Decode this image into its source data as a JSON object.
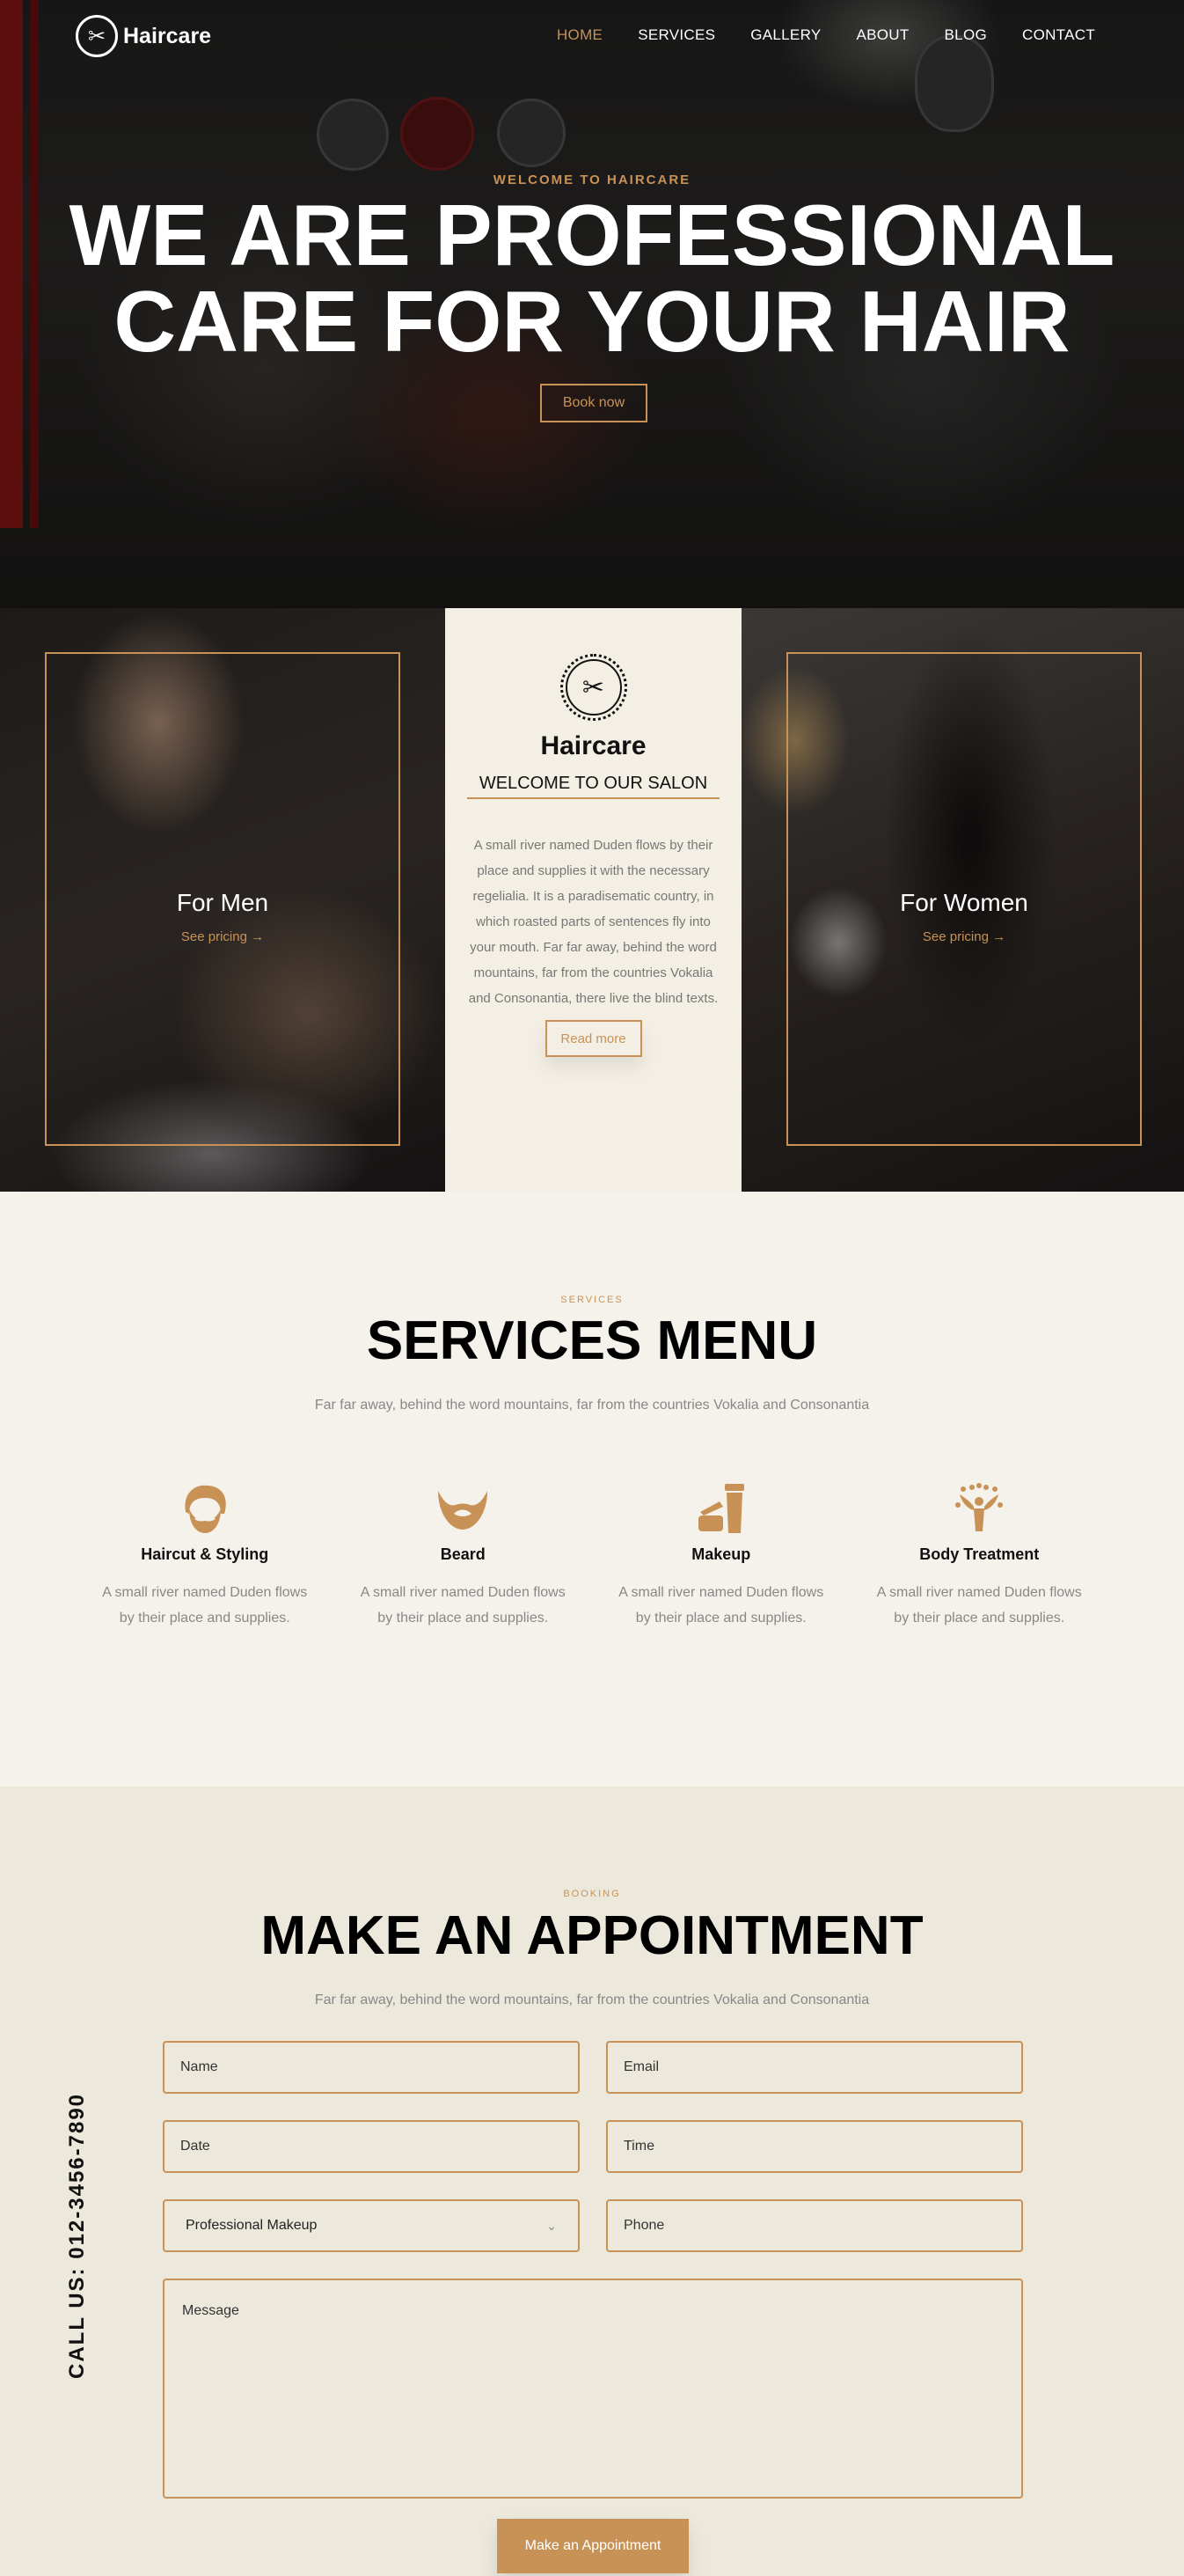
{
  "nav": {
    "logo": "Haircare",
    "items": [
      {
        "label": "HOME",
        "active": true
      },
      {
        "label": "SERVICES"
      },
      {
        "label": "GALLERY"
      },
      {
        "label": "ABOUT"
      },
      {
        "label": "BLOG"
      },
      {
        "label": "CONTACT"
      }
    ]
  },
  "hero": {
    "subtitle": "WELCOME TO HAIRCARE",
    "title_line1": "WE ARE PROFESSIONAL",
    "title_line2": "CARE FOR YOUR HAIR",
    "cta": "Book now"
  },
  "categories": {
    "men": {
      "title": "For Men",
      "link": "See pricing →"
    },
    "women": {
      "title": "For Women",
      "link": "See pricing →"
    },
    "center": {
      "brand": "Haircare",
      "heading": "WELCOME TO OUR SALON",
      "text": "A small river named Duden flows by their place and supplies it with the necessary regelialia. It is a paradisematic country, in which roasted parts of sentences fly into your mouth. Far far away, behind the word mountains, far from the countries Vokalia and Consonantia, there live the blind texts.",
      "button": "Read more"
    }
  },
  "services": {
    "label": "SERVICES",
    "title": "SERVICES MENU",
    "desc": "Far far away, behind the word mountains, far from the countries Vokalia and Consonantia",
    "items": [
      {
        "icon": "hair-mustache-icon",
        "title": "Haircut & Styling",
        "text": "A small river named Duden flows by their place and supplies."
      },
      {
        "icon": "beard-icon",
        "title": "Beard",
        "text": "A small river named Duden flows by their place and supplies."
      },
      {
        "icon": "makeup-icon",
        "title": "Makeup",
        "text": "A small river named Duden flows by their place and supplies."
      },
      {
        "icon": "body-treatment-icon",
        "title": "Body Treatment",
        "text": "A small river named Duden flows by their place and supplies."
      }
    ]
  },
  "booking": {
    "label": "BOOKING",
    "title": "MAKE AN APPOINTMENT",
    "desc": "Far far away, behind the word mountains, far from the countries Vokalia and Consonantia",
    "fields": {
      "name": "Name",
      "email": "Email",
      "date": "Date",
      "time": "Time",
      "service": "Professional Makeup",
      "phone": "Phone",
      "message": "Message"
    },
    "submit": "Make an Appointment",
    "call": "CALL US: 012-3456-7890"
  },
  "colors": {
    "accent": "#c89256",
    "dark": "#111111",
    "cream": "#f3efe4"
  }
}
